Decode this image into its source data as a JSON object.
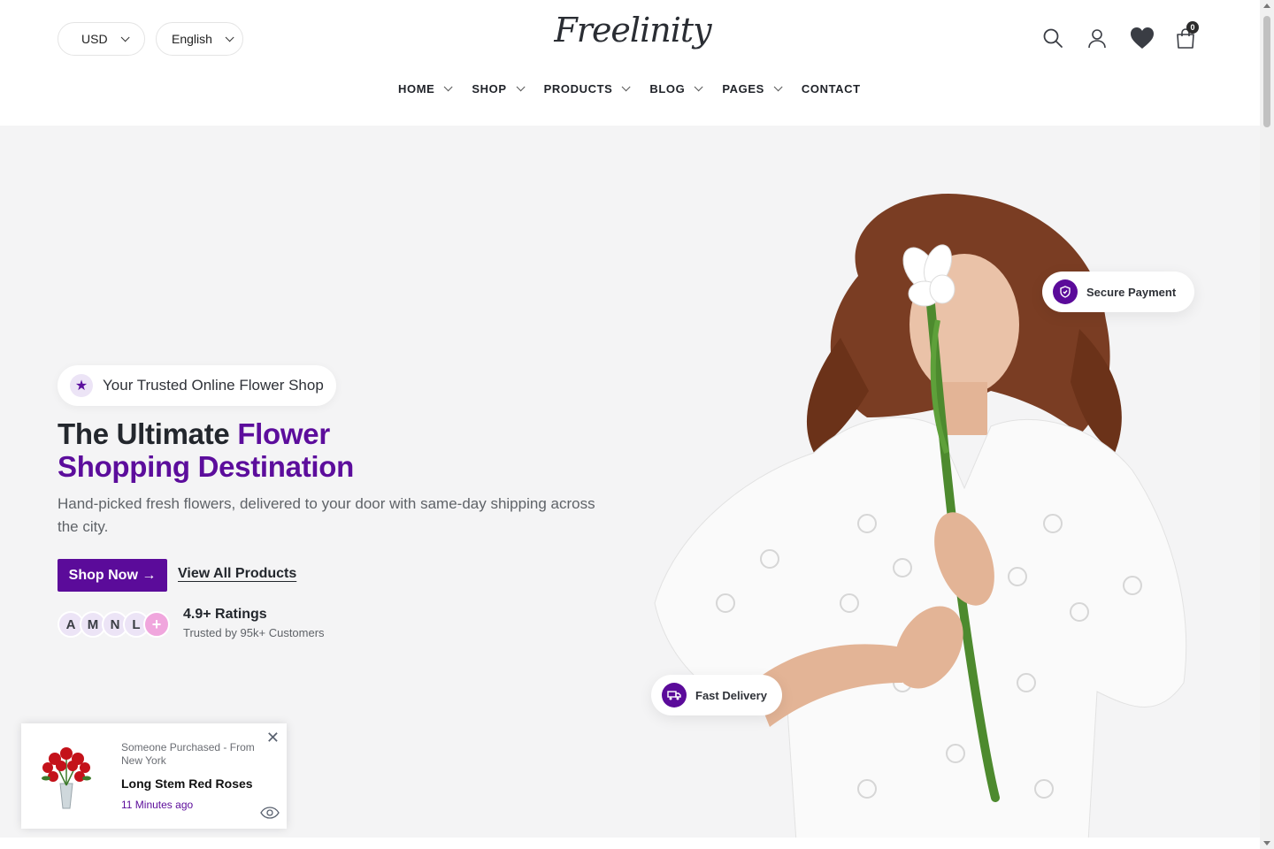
{
  "header": {
    "currency": "USD",
    "language": "English",
    "logo": "Freelinity",
    "cart_count": "0",
    "icons": [
      "search-icon",
      "account-icon",
      "heart-icon",
      "cart-icon"
    ]
  },
  "nav": {
    "items": [
      {
        "label": "HOME",
        "dropdown": true
      },
      {
        "label": "SHOP",
        "dropdown": true
      },
      {
        "label": "PRODUCTS",
        "dropdown": true
      },
      {
        "label": "BLOG",
        "dropdown": true
      },
      {
        "label": "PAGES",
        "dropdown": true
      },
      {
        "label": "CONTACT",
        "dropdown": false
      }
    ]
  },
  "hero": {
    "badge": "Your Trusted Online Flower Shop",
    "headline_part1": "The Ultimate ",
    "headline_accent1": "Flower",
    "headline_accent2": "Shopping Destination",
    "subtext": "Hand-picked fresh flowers, delivered to your door with same-day shipping across the city.",
    "primary_button": "Shop Now →",
    "secondary_link": "View All Products",
    "avatars": [
      "A",
      "M",
      "N",
      "L",
      "+"
    ],
    "rating_title": "4.9+ Ratings",
    "rating_sub": "Trusted by 95k+ Customers",
    "secure_payment": "Secure Payment",
    "fast_delivery": "Fast Delivery"
  },
  "popup": {
    "from": "Someone Purchased - From New York",
    "product": "Long Stem Red Roses",
    "time": "11 Minutes ago"
  },
  "colors": {
    "accent": "#5b0b9a",
    "hero_bg": "#f4f4f5",
    "avatar_plus": "#f0a6dd"
  }
}
